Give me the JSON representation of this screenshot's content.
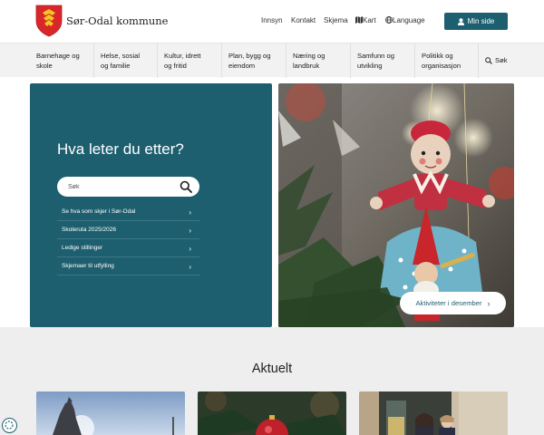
{
  "header": {
    "site_name": "Sør-Odal kommune",
    "links": [
      "Innsyn",
      "Kontakt",
      "Skjema",
      "Kart",
      "Language"
    ],
    "min_side_label": "Min side"
  },
  "nav": {
    "items": [
      "Barnehage og\nskole",
      "Helse, sosial\nog familie",
      "Kultur, idrett\nog fritid",
      "Plan, bygg og\neiendom",
      "Næring og\nlandbruk",
      "Samfunn og\nutvikling",
      "Politikk og\norganisasjon"
    ],
    "search_label": "Søk"
  },
  "hero": {
    "title": "Hva leter du etter?",
    "search_placeholder": "Søk",
    "quick_links": [
      "Se hva som skjer i Sør-Odal",
      "Skoleruta 2025/2026",
      "Ledige stillinger",
      "Skjemaer til utfylling"
    ],
    "activity_button": "Aktiviteter i desember"
  },
  "news": {
    "title": "Aktuelt"
  },
  "colors": {
    "primary": "#1d5f6e",
    "nav_bg": "#f2f2f2",
    "news_bg": "#eeeeee"
  }
}
